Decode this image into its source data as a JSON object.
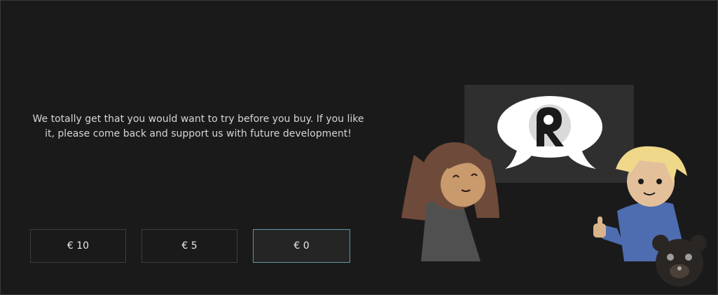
{
  "message": {
    "text": "We totally get that you would want to try before you buy. If you like it, please come back and support us with future development!"
  },
  "price_options": [
    {
      "label": "€ 10",
      "selected": false
    },
    {
      "label": "€ 5",
      "selected": false
    },
    {
      "label": "€ 0",
      "selected": true
    }
  ],
  "illustration": {
    "icons": [
      "speech-bubble-icon",
      "r-logo-icon",
      "thumbs-up-icon",
      "bear-watermark-icon"
    ]
  },
  "colors": {
    "background": "#1b1a1b",
    "text": "#d6d6d6",
    "selected_border": "#5e9aa6",
    "girl_hair": "#6e4a3a",
    "boy_hair": "#f0d88a",
    "boy_hoodie": "#4e6db0"
  }
}
